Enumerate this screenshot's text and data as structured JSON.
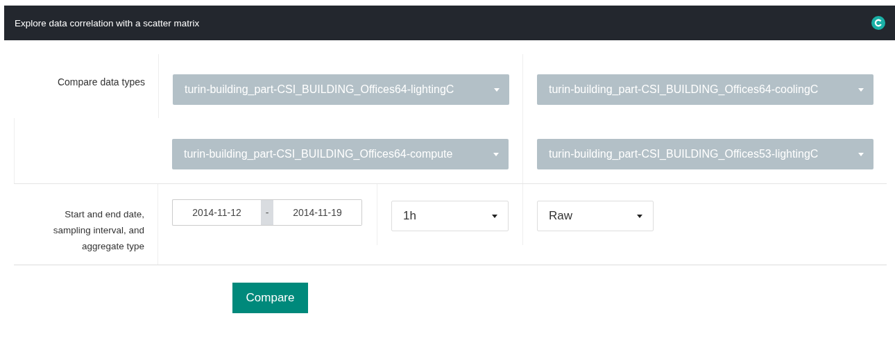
{
  "header": {
    "title": "Explore data correlation with a scatter matrix"
  },
  "data_types": {
    "label": "Compare data types",
    "options": [
      "turin-building_part-CSI_BUILDING_Offices64-lightingC",
      "turin-building_part-CSI_BUILDING_Offices64-coolingC",
      "turin-building_part-CSI_BUILDING_Offices64-compute",
      "turin-building_part-CSI_BUILDING_Offices53-lightingC"
    ]
  },
  "range": {
    "label": "Start and end date, sampling interval, and aggregate type",
    "start": "2014-11-12",
    "separator": "-",
    "end": "2014-11-19",
    "interval": "1h",
    "aggregate": "Raw"
  },
  "compare_button": "Compare"
}
